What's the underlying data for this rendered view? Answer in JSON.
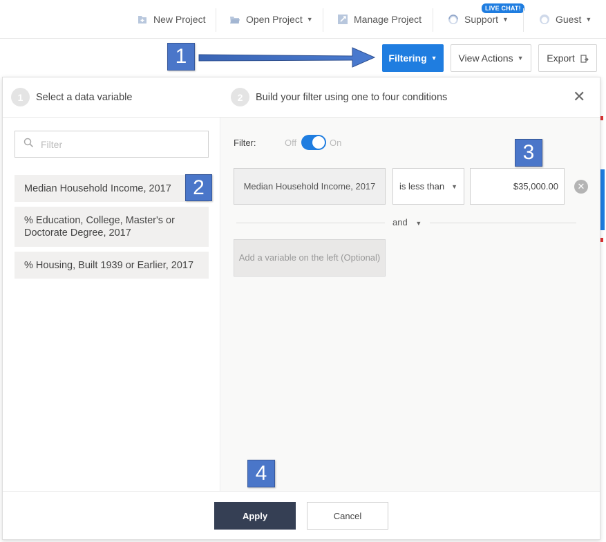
{
  "topnav": {
    "new_project": "New Project",
    "open_project": "Open Project",
    "manage_project": "Manage Project",
    "support": "Support",
    "live_chat": "LIVE CHAT!",
    "guest": "Guest"
  },
  "toolbar": {
    "filtering": "Filtering",
    "view_actions": "View Actions",
    "export": "Export"
  },
  "callouts": [
    "1",
    "2",
    "3",
    "4"
  ],
  "steps": {
    "step1_num": "1",
    "step1_label": "Select a data variable",
    "step2_num": "2",
    "step2_label": "Build your filter using one to four conditions"
  },
  "search": {
    "placeholder": "Filter"
  },
  "variables": [
    "Median Household Income, 2017",
    "% Education, College, Master's or Doctorate Degree, 2017",
    "% Housing, Built 1939 or Earlier, 2017"
  ],
  "filter": {
    "label": "Filter:",
    "off": "Off",
    "on": "On",
    "enabled": true
  },
  "condition": {
    "variable": "Median Household Income, 2017",
    "operator": "is less than",
    "value": "$35,000.00"
  },
  "connector": "and",
  "add_variable": "Add a variable on the left (Optional)",
  "footer": {
    "apply": "Apply",
    "cancel": "Cancel"
  },
  "colors": {
    "accent": "#1f7de0",
    "callout": "#4a76c9",
    "apply_bg": "#353f54"
  }
}
